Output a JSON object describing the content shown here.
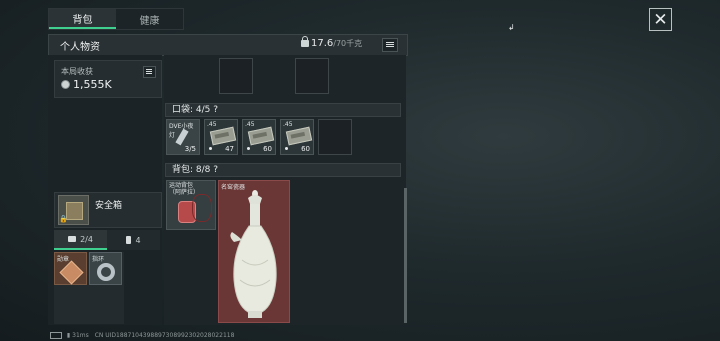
{
  "tabs": [
    {
      "label": "背包",
      "active": true
    },
    {
      "label": "健康",
      "active": false
    }
  ],
  "header": {
    "title": "个人物资",
    "weight_current": "17.6",
    "weight_max": "/70千克"
  },
  "earnings": {
    "label": "本局收获",
    "value": "1,555K"
  },
  "safe_box": {
    "label": "安全箱"
  },
  "sub_tabs": [
    {
      "count": "2/4",
      "icon": "bag-icon"
    },
    {
      "count": "4",
      "icon": "battery-icon"
    }
  ],
  "small_items": [
    {
      "name": "勋章"
    },
    {
      "name": "指环"
    }
  ],
  "pocket": {
    "label": "口袋: 4/5 ?",
    "items": [
      {
        "name": "DVE小夜灯",
        "count": "3/5"
      },
      {
        "name": ".45",
        "count": "47"
      },
      {
        "name": ".45",
        "count": "60"
      },
      {
        "name": ".45",
        "count": "60"
      }
    ]
  },
  "backpack": {
    "label": "背包: 8/8 ?",
    "items": [
      {
        "name": "运动背包（阿萨拉）"
      },
      {
        "name": "名窑瓷器"
      }
    ]
  },
  "footer": {
    "ping": "31ms",
    "uid": "CN UID1887104398897308992302028022118"
  },
  "colors": {
    "accent": "#3fcf8e",
    "backpack_slot": "#6b3636"
  }
}
